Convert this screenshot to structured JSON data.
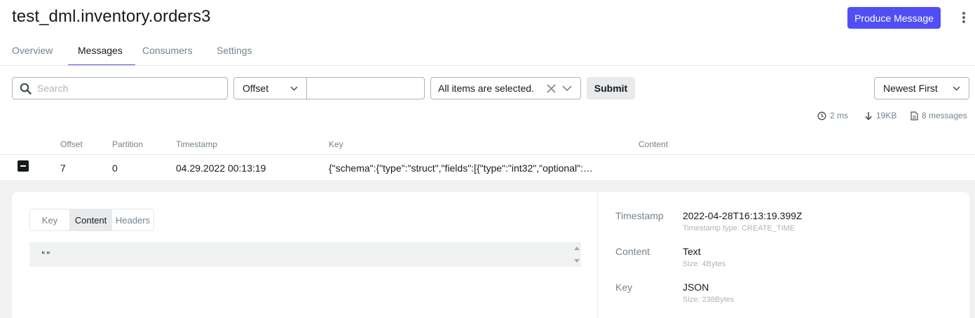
{
  "header": {
    "title": "test_dml.inventory.orders3",
    "produce_label": "Produce Message"
  },
  "tabs": [
    {
      "label": "Overview"
    },
    {
      "label": "Messages"
    },
    {
      "label": "Consumers"
    },
    {
      "label": "Settings"
    }
  ],
  "filters": {
    "search_placeholder": "Search",
    "offset_mode": "Offset",
    "offset_value": "",
    "partitions_label": "All items are selected.",
    "submit_label": "Submit",
    "sort_label": "Newest First"
  },
  "stats": {
    "elapsed": "2 ms",
    "bytes": "19KB",
    "messages": "8 messages"
  },
  "table": {
    "columns": [
      "Offset",
      "Partition",
      "Timestamp",
      "Key",
      "Content"
    ],
    "row": {
      "offset": "7",
      "partition": "0",
      "timestamp": "04.29.2022 00:13:19",
      "key": "{\"schema\":{\"type\":\"struct\",\"fields\":[{\"type\":\"int32\",\"optional\":…",
      "content": ""
    }
  },
  "details": {
    "tabs": [
      {
        "label": "Key"
      },
      {
        "label": "Content"
      },
      {
        "label": "Headers"
      }
    ],
    "content_text": "\"\"",
    "meta": {
      "timestamp_label": "Timestamp",
      "timestamp_value": "2022-04-28T16:13:19.399Z",
      "timestamp_sub": "Timestamp type: CREATE_TIME",
      "content_label": "Content",
      "content_value": "Text",
      "content_sub": "Size: 4Bytes",
      "key_label": "Key",
      "key_value": "JSON",
      "key_sub": "Size: 238Bytes"
    }
  },
  "colors": {
    "accent": "#4f4ff5",
    "muted": "#73848c"
  }
}
